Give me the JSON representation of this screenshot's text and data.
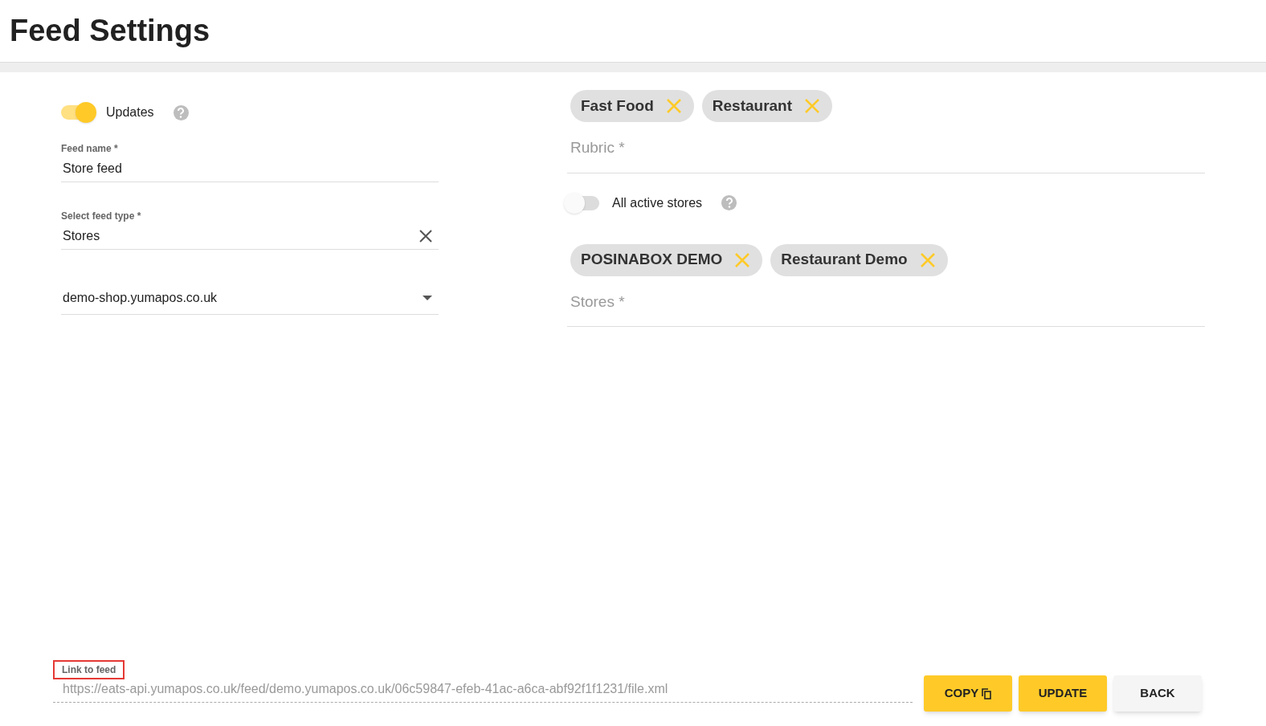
{
  "page": {
    "title": "Feed Settings"
  },
  "updates_toggle": {
    "label": "Updates",
    "on": true
  },
  "feed_name": {
    "label": "Feed name *",
    "value": "Store feed"
  },
  "feed_type": {
    "label": "Select feed type *",
    "value": "Stores"
  },
  "domain_select": {
    "value": "demo-shop.yumapos.co.uk"
  },
  "rubric": {
    "chips": [
      "Fast Food",
      "Restaurant"
    ],
    "placeholder": "Rubric *"
  },
  "all_stores_toggle": {
    "label": "All active stores",
    "on": false
  },
  "stores": {
    "chips": [
      "POSINABOX DEMO",
      "Restaurant Demo"
    ],
    "placeholder": "Stores *"
  },
  "feed_link": {
    "label": "Link to feed",
    "highlighted": true,
    "value": "https://eats-api.yumapos.co.uk/feed/demo.yumapos.co.uk/06c59847-efeb-41ac-a6ca-abf92f1f1231/file.xml"
  },
  "buttons": [
    {
      "label": "COPY",
      "kind": "copy"
    },
    {
      "label": "UPDATE",
      "kind": "primary"
    },
    {
      "label": "BACK",
      "kind": "secondary"
    }
  ]
}
